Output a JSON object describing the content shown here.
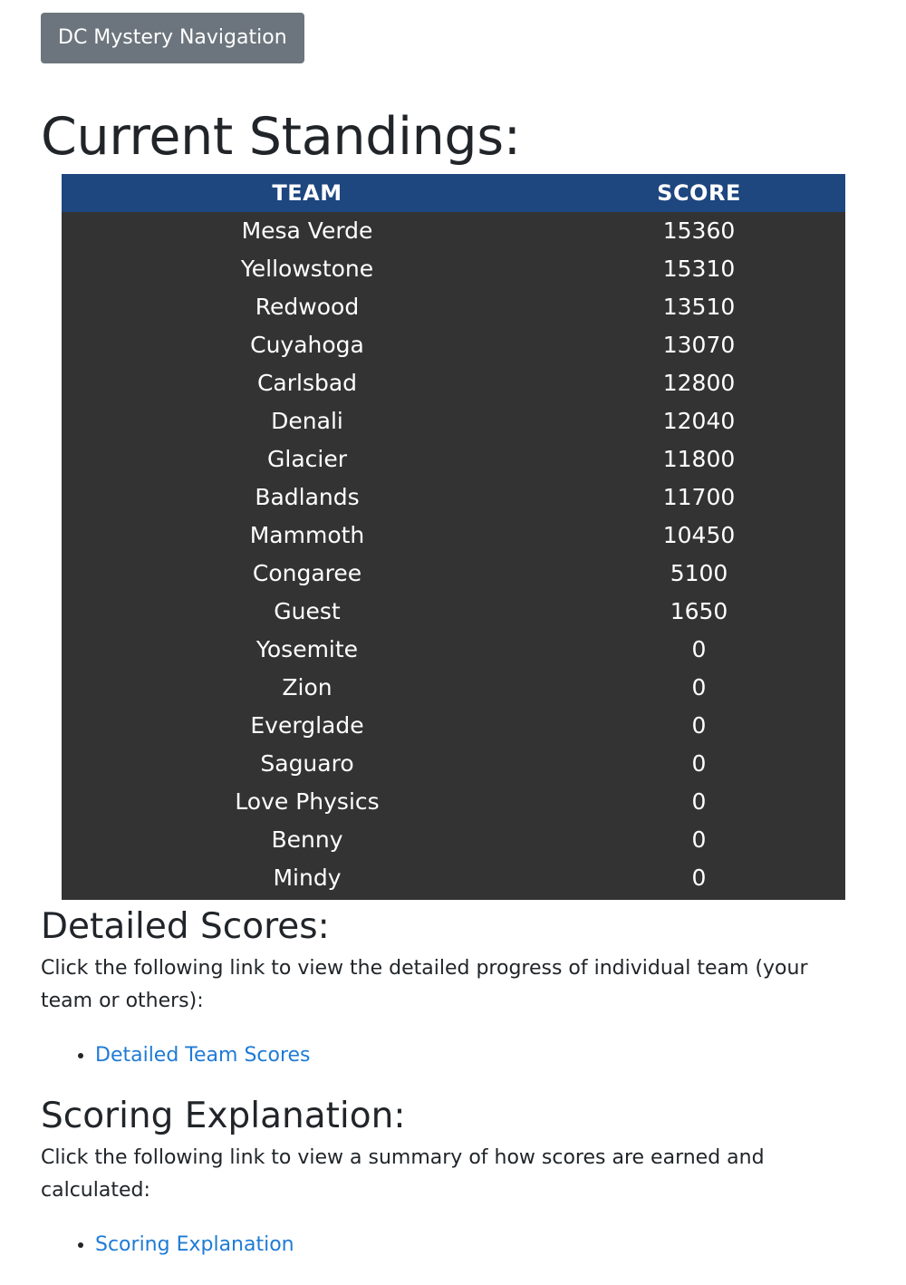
{
  "nav": {
    "button_label": "DC Mystery Navigation"
  },
  "standings": {
    "title": "Current Standings:",
    "columns": [
      "TEAM",
      "SCORE"
    ],
    "rows": [
      {
        "team": "Mesa Verde",
        "score": "15360"
      },
      {
        "team": "Yellowstone",
        "score": "15310"
      },
      {
        "team": "Redwood",
        "score": "13510"
      },
      {
        "team": "Cuyahoga",
        "score": "13070"
      },
      {
        "team": "Carlsbad",
        "score": "12800"
      },
      {
        "team": "Denali",
        "score": "12040"
      },
      {
        "team": "Glacier",
        "score": "11800"
      },
      {
        "team": "Badlands",
        "score": "11700"
      },
      {
        "team": "Mammoth",
        "score": "10450"
      },
      {
        "team": "Congaree",
        "score": "5100"
      },
      {
        "team": "Guest",
        "score": "1650"
      },
      {
        "team": "Yosemite",
        "score": "0"
      },
      {
        "team": "Zion",
        "score": "0"
      },
      {
        "team": "Everglade",
        "score": "0"
      },
      {
        "team": "Saguaro",
        "score": "0"
      },
      {
        "team": "Love Physics",
        "score": "0"
      },
      {
        "team": "Benny",
        "score": "0"
      },
      {
        "team": "Mindy",
        "score": "0"
      }
    ]
  },
  "detailed": {
    "title": "Detailed Scores:",
    "text": "Click the following link to view the detailed progress of individual team (your team or others):",
    "link_label": "Detailed Team Scores"
  },
  "scoring": {
    "title": "Scoring Explanation:",
    "text": "Click the following link to view a summary of how scores are earned and calculated:",
    "link_label": "Scoring Explanation"
  },
  "colors": {
    "nav_button_bg": "#6c757d",
    "table_header_bg": "#1e467f",
    "table_body_bg": "#333333",
    "link": "#1f7bd5"
  }
}
